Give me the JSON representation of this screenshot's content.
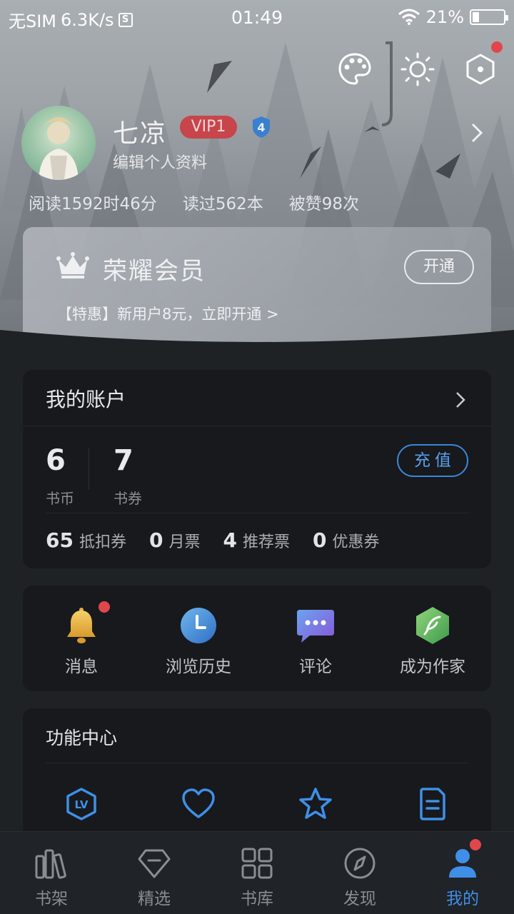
{
  "status_bar": {
    "carrier": "无SIM",
    "speed": "6.3K/s",
    "sim_icon_text": "S",
    "time": "01:49",
    "battery": "21%",
    "battery_level": 0.21
  },
  "header_icons": [
    "palette-icon",
    "brightness-icon",
    "settings-hex-icon"
  ],
  "profile": {
    "name": "七凉",
    "vip_badge": "VIP1",
    "level": "4",
    "edit_label": "编辑个人资料",
    "stats": [
      "阅读1592时46分",
      "读过562本",
      "被赞98次"
    ]
  },
  "vip_card": {
    "title": "荣耀会员",
    "open_button": "开通",
    "promo": "【特惠】新用户8元，立即开通 >"
  },
  "account": {
    "title": "我的账户",
    "coins_value": "6",
    "coins_label": "书币",
    "vouchers_value": "7",
    "vouchers_label": "书券",
    "recharge": "充值",
    "tickets": [
      {
        "count": "65",
        "label": "抵扣券"
      },
      {
        "count": "0",
        "label": "月票"
      },
      {
        "count": "4",
        "label": "推荐票"
      },
      {
        "count": "0",
        "label": "优惠券"
      }
    ]
  },
  "shortcuts": [
    {
      "label": "消息",
      "icon": "bell-icon"
    },
    {
      "label": "浏览历史",
      "icon": "clock-icon"
    },
    {
      "label": "评论",
      "icon": "chat-bubble-icon"
    },
    {
      "label": "成为作家",
      "icon": "feather-icon"
    }
  ],
  "function_center": {
    "title": "功能中心",
    "icons": [
      "level-icon",
      "heart-icon",
      "star-icon",
      "document-icon"
    ]
  },
  "bottom_nav": [
    {
      "label": "书架",
      "icon": "bookshelf-icon"
    },
    {
      "label": "精选",
      "icon": "diamond-icon"
    },
    {
      "label": "书库",
      "icon": "grid-icon"
    },
    {
      "label": "发现",
      "icon": "compass-icon"
    },
    {
      "label": "我的",
      "icon": "user-icon",
      "active": true
    }
  ],
  "colors": {
    "accent": "#3f8fe8",
    "vip_red": "#c7454b",
    "notification_dot": "#e0474c",
    "card_bg": "#17191c",
    "page_bg": "#1f2225"
  }
}
